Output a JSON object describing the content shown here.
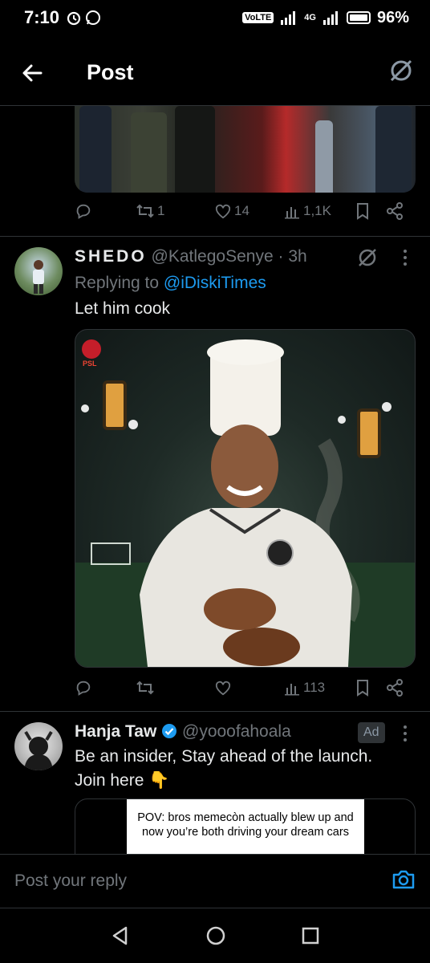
{
  "status": {
    "time": "7:10",
    "volte": "VoLTE",
    "network": "4G",
    "battery": "96%"
  },
  "header": {
    "title": "Post"
  },
  "prev_post": {
    "replies": "",
    "reposts": "1",
    "likes": "14",
    "views": "1,1K"
  },
  "reply_post": {
    "name": "SHEDO",
    "handle": "@KatlegoSenye",
    "dot": "·",
    "time": "3h",
    "replying_label": "Replying to",
    "replying_to": "@iDiskiTimes",
    "text": "Let him cook",
    "image_logo": "PSL",
    "views": "113"
  },
  "ad_post": {
    "name": "Hanja Taw",
    "handle": "@yooofahoala",
    "ad_label": "Ad",
    "text_line1": "Be an insider, Stay ahead of the launch.",
    "text_line2": "Join here",
    "emoji": "👇",
    "card_caption": "POV: bros memecòn  actually blew up and now you’re both driving your dream cars"
  },
  "reply_box": {
    "placeholder": "Post your reply"
  },
  "colors": {
    "accent": "#1d9bf0",
    "muted": "#71767b",
    "background": "#000000"
  }
}
